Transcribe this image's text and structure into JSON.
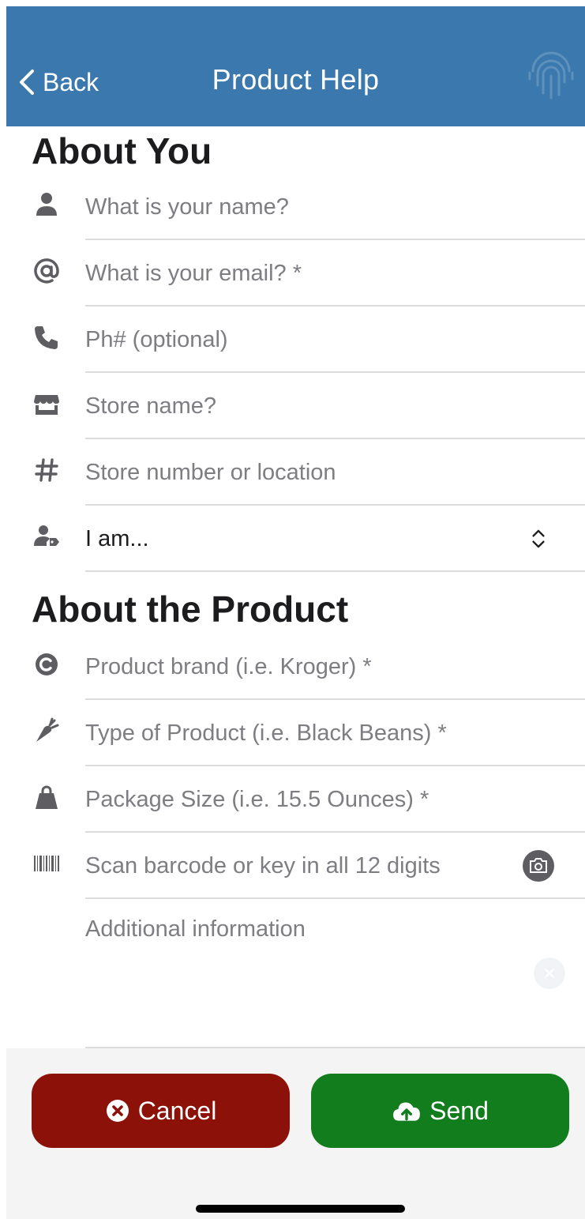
{
  "header": {
    "back_label": "Back",
    "title": "Product Help",
    "background": "#3a78ad"
  },
  "about_you": {
    "title": "About You",
    "fields": [
      {
        "icon": "person-icon",
        "placeholder": "What is your name?"
      },
      {
        "icon": "at-icon",
        "placeholder": "What is your email? *"
      },
      {
        "icon": "phone-icon",
        "placeholder": "Ph# (optional)"
      },
      {
        "icon": "store-icon",
        "placeholder": "Store name?"
      },
      {
        "icon": "hash-icon",
        "placeholder": "Store number or location"
      }
    ],
    "role_select": {
      "icon": "user-tag-icon",
      "value": "I am..."
    }
  },
  "about_product": {
    "title": "About the Product",
    "fields": [
      {
        "icon": "copyright-icon",
        "placeholder": "Product brand (i.e. Kroger) *"
      },
      {
        "icon": "carrot-icon",
        "placeholder": "Type of Product (i.e. Black Beans) *"
      },
      {
        "icon": "bag-icon",
        "placeholder": "Package Size (i.e. 15.5 Ounces) *"
      },
      {
        "icon": "barcode-icon",
        "placeholder": "Scan barcode or key in all 12 digits"
      }
    ],
    "additional_placeholder": "Additional information"
  },
  "footer": {
    "cancel_label": "Cancel",
    "send_label": "Send",
    "cancel_color": "#8c1209",
    "send_color": "#127d1d"
  }
}
